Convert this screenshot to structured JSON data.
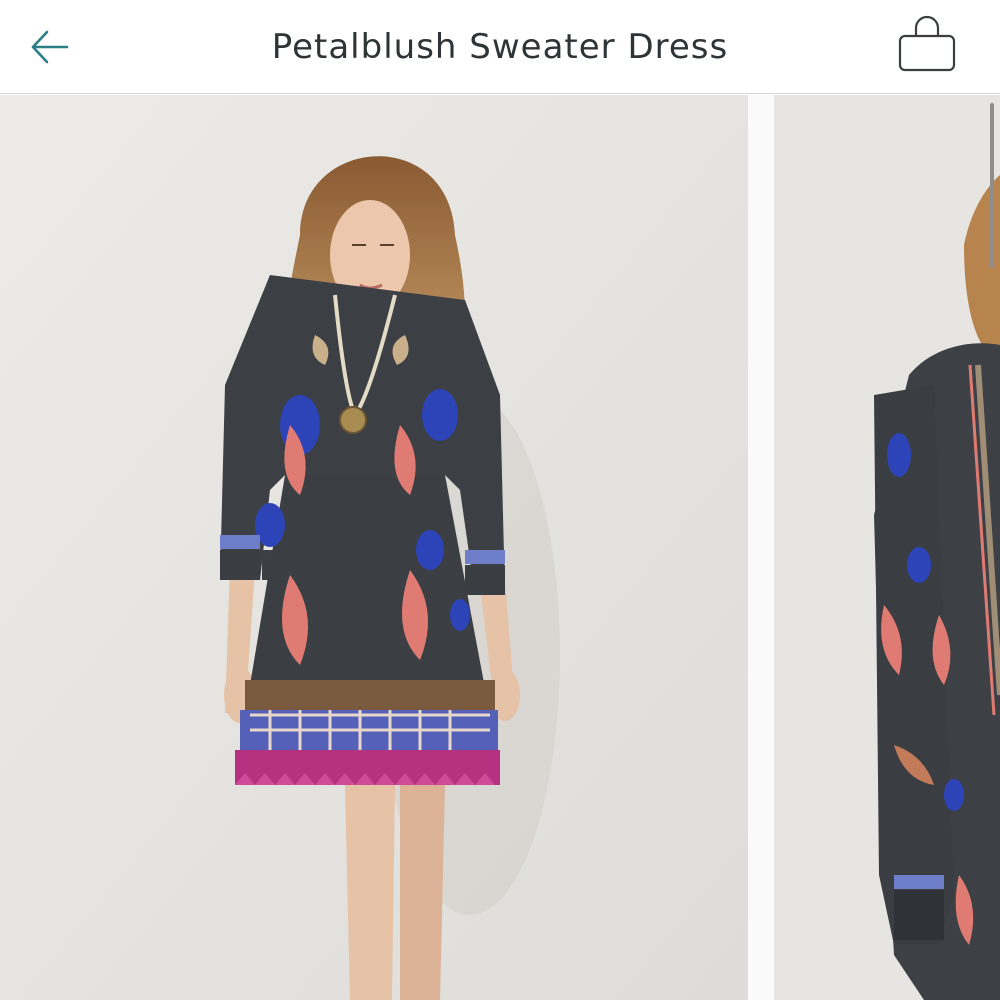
{
  "header": {
    "title": "Petalblush Sweater Dress",
    "back_icon": "arrow-left-icon",
    "bag_icon": "shopping-bag-icon",
    "accent_color": "#2a7f86"
  },
  "gallery": {
    "images": [
      {
        "name": "product-image-front",
        "description_icon": "model-front-photo"
      },
      {
        "name": "product-image-side",
        "description_icon": "model-side-photo"
      }
    ]
  }
}
